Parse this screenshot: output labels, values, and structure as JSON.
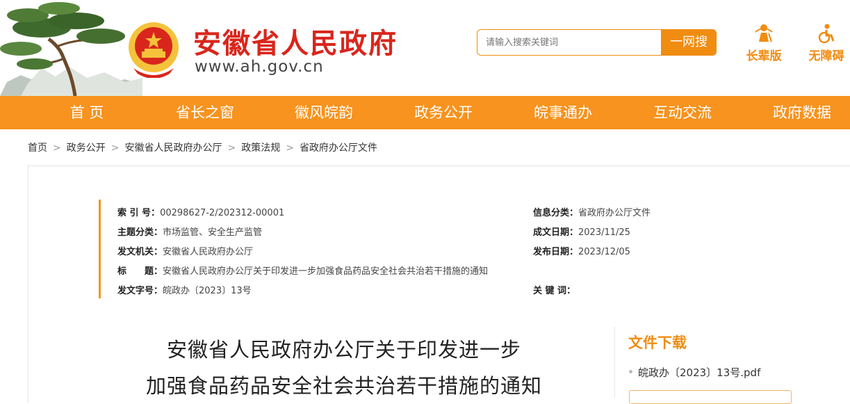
{
  "header": {
    "site_title": "安徽省人民政府",
    "site_url": "www.ah.gov.cn",
    "search": {
      "placeholder": "请输入搜索关键词",
      "button_label": "一网搜"
    },
    "tools": [
      {
        "label": "长辈版",
        "icon": "elder-icon"
      },
      {
        "label": "无障碍",
        "icon": "accessibility-icon"
      }
    ]
  },
  "nav": {
    "items": [
      {
        "label": "首 页"
      },
      {
        "label": "省长之窗"
      },
      {
        "label": "徽风皖韵"
      },
      {
        "label": "政务公开"
      },
      {
        "label": "皖事通办"
      },
      {
        "label": "互动交流"
      },
      {
        "label": "政府数据"
      }
    ]
  },
  "breadcrumb": [
    "首页",
    "政务公开",
    "安徽省人民政府办公厅",
    "政策法规",
    "省政府办公厅文件"
  ],
  "breadcrumb_separator": ">",
  "meta": {
    "index_label": "索 引 号：",
    "index_value": "00298627-2/202312-00001",
    "category_label": "信息分类：",
    "category_value": "省政府办公厅文件",
    "topic_label": "主题分类：",
    "topic_value": "市场监管、安全生产监管",
    "created_label": "成文日期：",
    "created_value": "2023/11/25",
    "issuer_label": "发文机关：",
    "issuer_value": "安徽省人民政府办公厅",
    "published_label": "发布日期：",
    "published_value": "2023/12/05",
    "title_label": "标　　题：",
    "title_value": "安徽省人民政府办公厅关于印发进一步加强食品药品安全社会共治若干措施的通知",
    "docno_label": "发文字号：",
    "docno_value": "皖政办〔2023〕13号",
    "keywords_label": "关 键 词：",
    "keywords_value": ""
  },
  "article": {
    "title_line1": "安徽省人民政府办公厅关于印发进一步",
    "title_line2": "加强食品药品安全社会共治若干措施的通知"
  },
  "downloads": {
    "title": "文件下载",
    "items": [
      {
        "label": "皖政办〔2023〕13号.pdf"
      }
    ]
  },
  "colors": {
    "brand_orange": "#f7931e",
    "title_red": "#d9261c"
  }
}
